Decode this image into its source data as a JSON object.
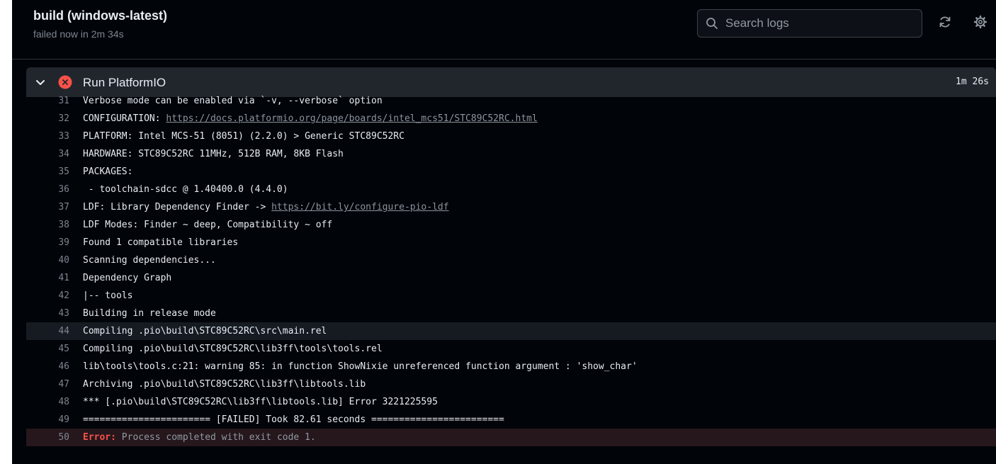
{
  "job": {
    "title": "build (windows-latest)",
    "status": "failed now in 2m 34s"
  },
  "search": {
    "placeholder": "Search logs"
  },
  "icons": {
    "search": "search-icon",
    "refresh": "refresh-icon",
    "settings": "gear-icon",
    "collapse": "chevron-down-icon",
    "failed": "x-circle-icon"
  },
  "colors": {
    "failed": "#f85149",
    "background": "#010409",
    "step_header": "#21262d"
  },
  "step": {
    "title": "Run PlatformIO",
    "duration": "1m 26s"
  },
  "log": {
    "lines": [
      {
        "n": "31",
        "text": "Verbose mode can be enabled via `-v, --verbose` option"
      },
      {
        "n": "32",
        "text": "CONFIGURATION: ",
        "link": "https://docs.platformio.org/page/boards/intel_mcs51/STC89C52RC.html"
      },
      {
        "n": "33",
        "text": "PLATFORM: Intel MCS-51 (8051) (2.2.0) > Generic STC89C52RC"
      },
      {
        "n": "34",
        "text": "HARDWARE: STC89C52RC 11MHz, 512B RAM, 8KB Flash"
      },
      {
        "n": "35",
        "text": "PACKAGES:"
      },
      {
        "n": "36",
        "text": " - toolchain-sdcc @ 1.40400.0 (4.4.0)"
      },
      {
        "n": "37",
        "text": "LDF: Library Dependency Finder -> ",
        "link": "https://bit.ly/configure-pio-ldf"
      },
      {
        "n": "38",
        "text": "LDF Modes: Finder ~ deep, Compatibility ~ off"
      },
      {
        "n": "39",
        "text": "Found 1 compatible libraries"
      },
      {
        "n": "40",
        "text": "Scanning dependencies..."
      },
      {
        "n": "41",
        "text": "Dependency Graph"
      },
      {
        "n": "42",
        "text": "|-- tools"
      },
      {
        "n": "43",
        "text": "Building in release mode"
      },
      {
        "n": "44",
        "text": "Compiling .pio\\build\\STC89C52RC\\src\\main.rel",
        "highlight": true
      },
      {
        "n": "45",
        "text": "Compiling .pio\\build\\STC89C52RC\\lib3ff\\tools\\tools.rel"
      },
      {
        "n": "46",
        "text": "lib\\tools\\tools.c:21: warning 85: in function ShowNixie unreferenced function argument : 'show_char'"
      },
      {
        "n": "47",
        "text": "Archiving .pio\\build\\STC89C52RC\\lib3ff\\libtools.lib"
      },
      {
        "n": "48",
        "text": "*** [.pio\\build\\STC89C52RC\\lib3ff\\libtools.lib] Error 3221225595"
      },
      {
        "n": "49",
        "text": "======================= [FAILED] Took 82.61 seconds ========================"
      },
      {
        "n": "50",
        "error_label": "Error:",
        "text": " Process completed with exit code 1.",
        "error": true
      }
    ]
  }
}
